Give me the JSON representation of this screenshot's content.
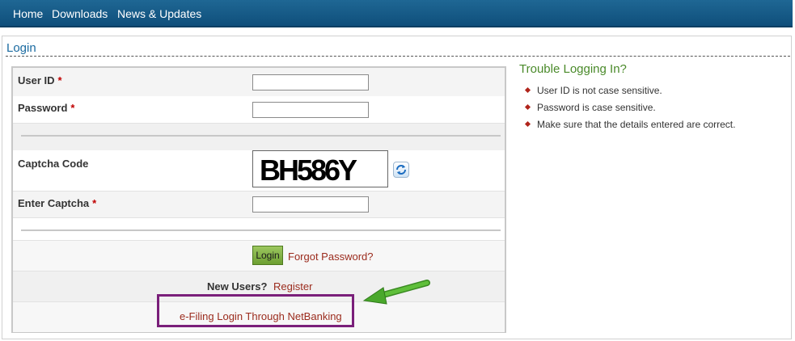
{
  "nav": {
    "items": [
      "Home",
      "Downloads",
      "News & Updates"
    ]
  },
  "panel": {
    "title": "Login"
  },
  "form": {
    "user_id_label": "User ID",
    "password_label": "Password",
    "captcha_label": "Captcha Code",
    "captcha_text": "BH586Y",
    "enter_captcha_label": "Enter Captcha",
    "required_mark": "*",
    "user_id_value": "",
    "password_value": "",
    "enter_captcha_value": "",
    "login_button": "Login",
    "forgot_password": "Forgot Password?",
    "new_users_label": "New Users?",
    "register_link": "Register",
    "netbanking_link": "e-Filing Login Through NetBanking"
  },
  "help": {
    "title": "Trouble Logging In?",
    "tips": [
      "User ID is not case sensitive.",
      "Password is case sensitive.",
      "Make sure that the details entered are correct."
    ]
  },
  "colors": {
    "nav_bg": "#1a6190",
    "link": "#9b2b1d",
    "help_title": "#4a8a2a",
    "highlight_box": "#7a1f7a",
    "arrow": "#3f9a2a",
    "login_button": "#86b34a"
  },
  "icons": {
    "refresh": "refresh-captcha-icon",
    "arrow": "green-arrow-icon",
    "bullet": "red-diamond-bullet-icon"
  }
}
